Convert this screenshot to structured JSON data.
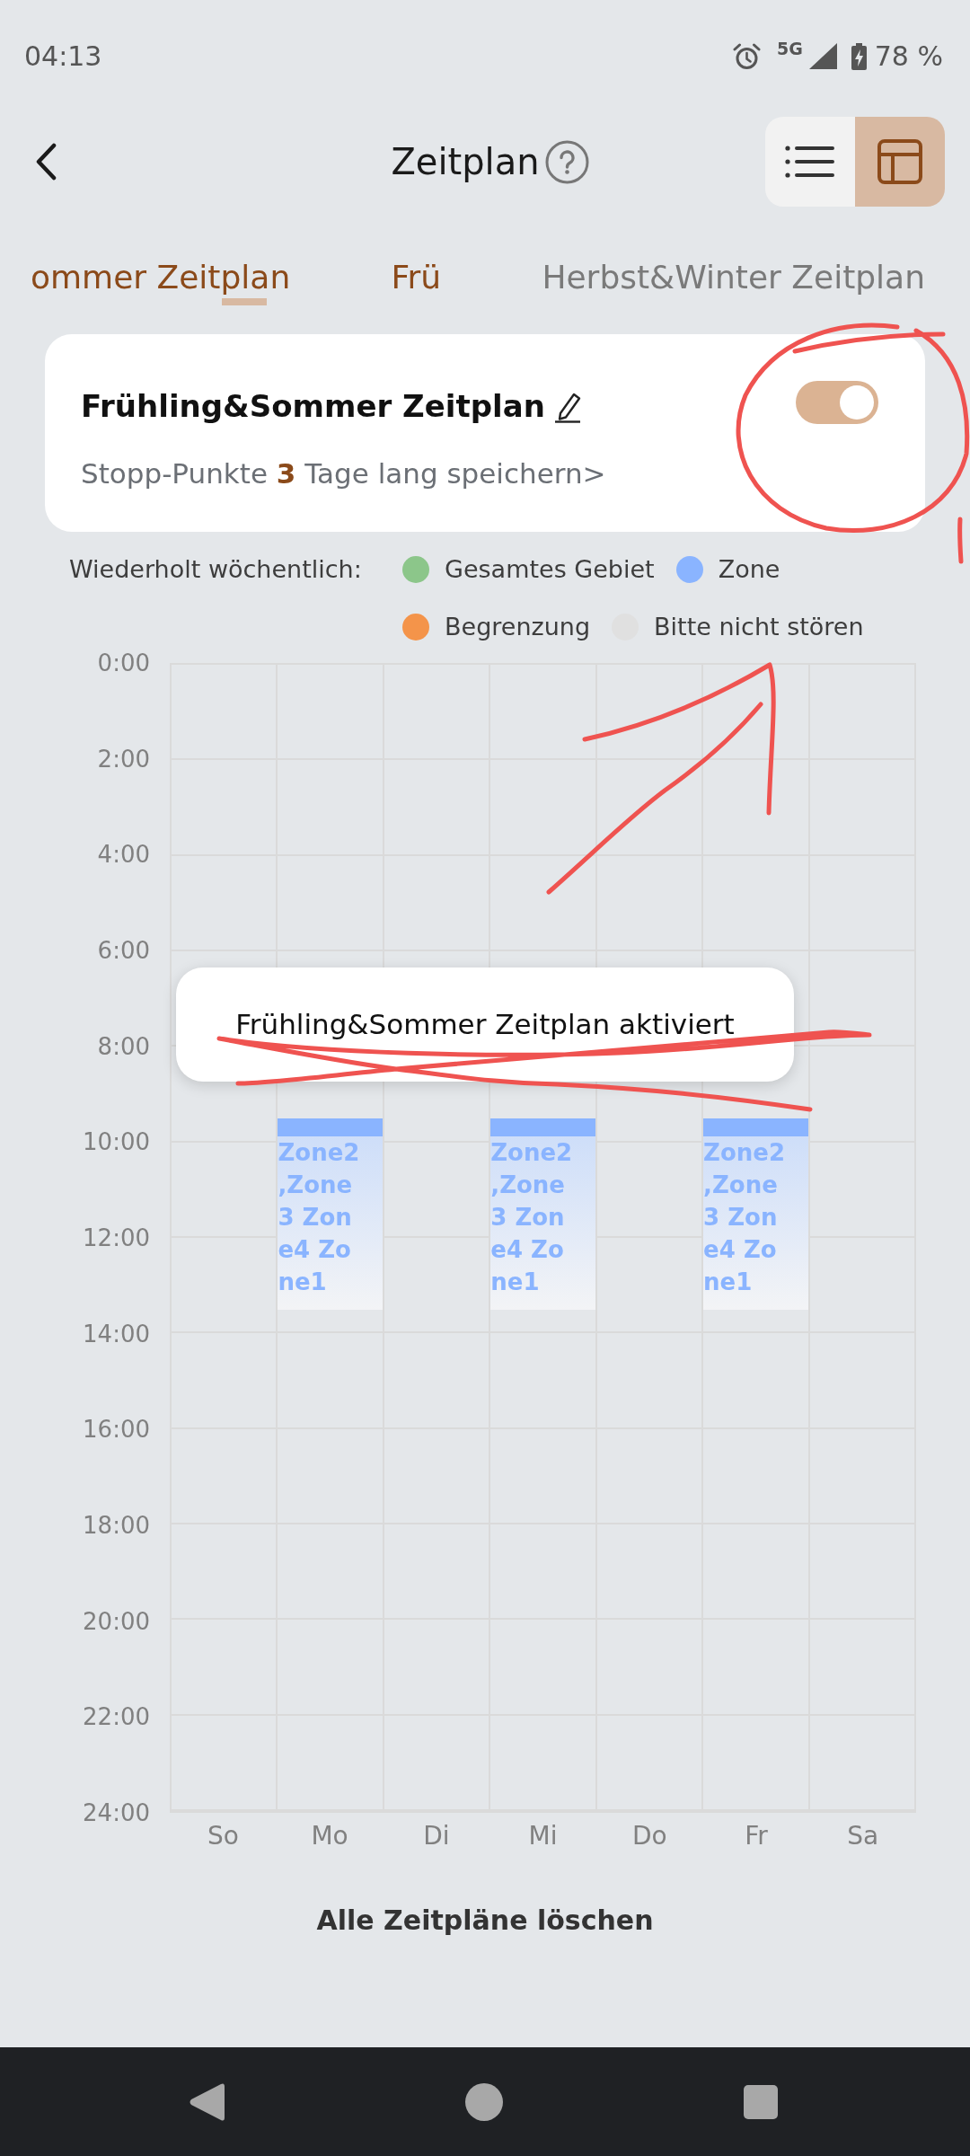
{
  "status_bar": {
    "time": "04:13",
    "network": "5G",
    "battery": "78 %"
  },
  "header": {
    "title": "Zeitplan",
    "view_switch": [
      {
        "kind": "list",
        "selected": false
      },
      {
        "kind": "calendar",
        "selected": true
      }
    ]
  },
  "tabs": [
    {
      "label": "ommer Zeitplan",
      "selected": true,
      "highlighted": true
    },
    {
      "label": "Frü",
      "selected": false,
      "highlighted": true
    },
    {
      "label": "Herbst&Winter Zeitplan",
      "selected": false,
      "highlighted": false
    }
  ],
  "schedule_card": {
    "title": "Frühling&Sommer Zeitplan",
    "enabled": true,
    "note": "Stopp-Punkte **3** Tage lang speichern>"
  },
  "legend": {
    "label": "Wiederholt wöchentlich:",
    "items": [
      {
        "label": "Gesamtes Gebiet",
        "color": "#8cc68a"
      },
      {
        "label": "Zone",
        "color": "#8ab4ff"
      },
      {
        "label": "Begrenzung",
        "color": "#f4944a"
      },
      {
        "label": "Bitte nicht stören",
        "color": "#e0e0e0"
      }
    ]
  },
  "week_grid": {
    "hours": [
      "0:00",
      "2:00",
      "4:00",
      "6:00",
      "8:00",
      "10:00",
      "12:00",
      "14:00",
      "16:00",
      "18:00",
      "20:00",
      "22:00",
      "24:00"
    ],
    "days": [
      {
        "label": "So"
      },
      {
        "label": "Mo",
        "entries": [
          {
            "text": "Zone2,Zone3 Zone4 Zone1",
            "color": "#8ab4ff"
          }
        ]
      },
      {
        "label": "Di"
      },
      {
        "label": "Mi",
        "entries": [
          {
            "text": "Zone2,Zone3 Zone4 Zone1",
            "color": "#8ab4ff"
          }
        ]
      },
      {
        "label": "Do"
      },
      {
        "label": "Fr",
        "entries": [
          {
            "text": "Zone2,Zone3 Zone4 Zone1",
            "color": "#8ab4ff"
          }
        ]
      },
      {
        "label": "Sa"
      }
    ]
  },
  "toast": {
    "text": "Frühling&Sommer Zeitplan aktiviert"
  },
  "delete_all": {
    "label": "Alle Zeitpläne löschen"
  },
  "annotations": [
    {
      "kind": "circle"
    },
    {
      "kind": "arrow"
    },
    {
      "kind": "strike"
    }
  ]
}
